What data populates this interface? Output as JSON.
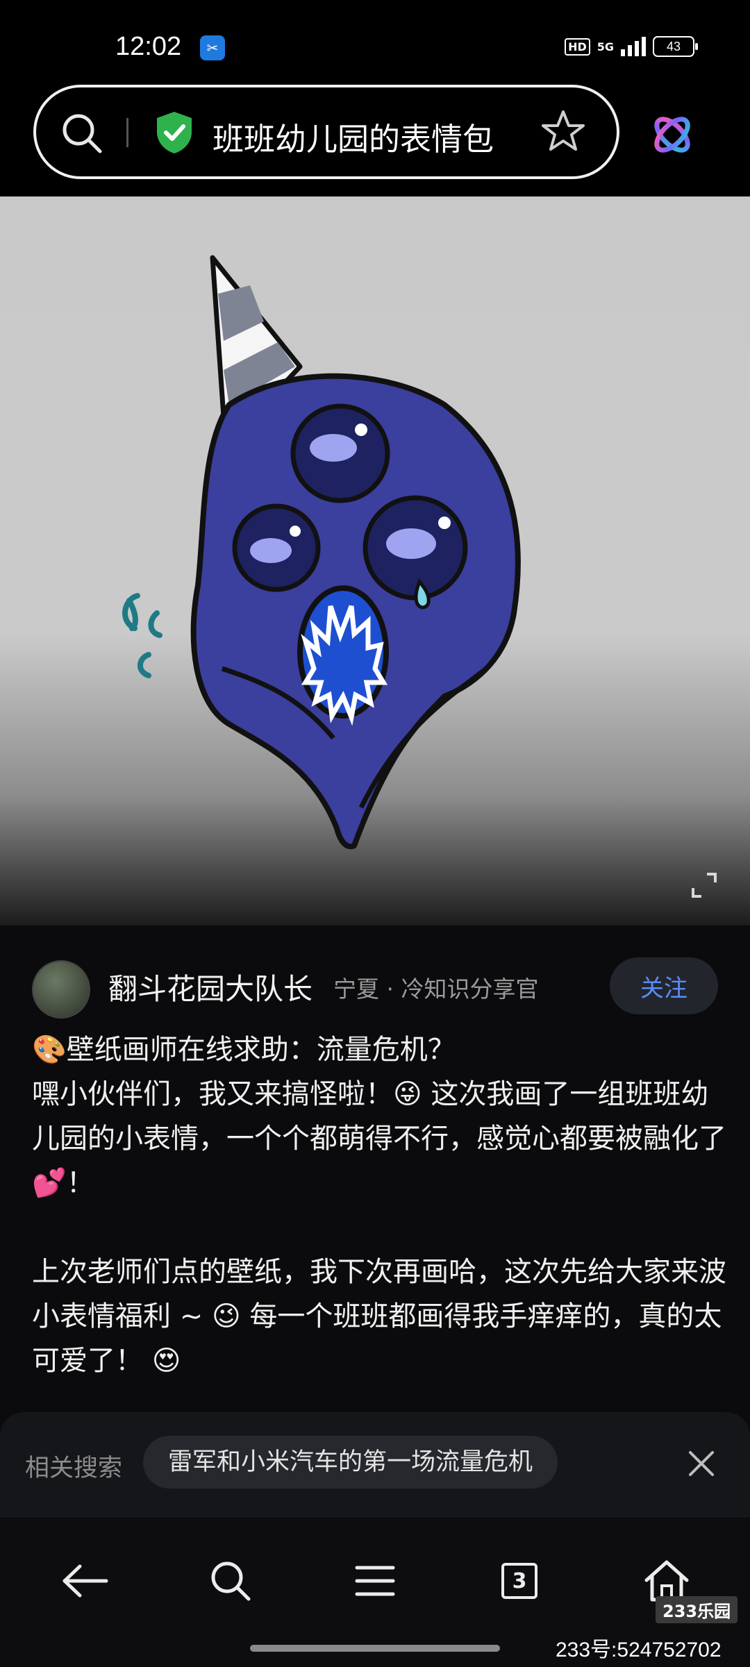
{
  "status": {
    "time": "12:02",
    "hd": "HD",
    "network": "5G",
    "battery": "43"
  },
  "search": {
    "query": "班班幼儿园的表情包"
  },
  "post": {
    "author": "翻斗花园大队长",
    "meta": "宁夏 · 冷知识分享官",
    "follow_label": "关注",
    "lines": [
      "🎨壁纸画师在线求助：流量危机？",
      "嘿小伙伴们，我又来搞怪啦！😜 这次我画了一组班班幼儿园的小表情，一个个都萌得不行，感觉心都要被融化了💕！",
      "上次老师们点的壁纸，我下次再画哈，这次先给大家来波小表情福利 ~ 😉 每一个班班都画得我手痒痒的，真的太可爱了！ 😍"
    ]
  },
  "related": {
    "label": "相关搜索",
    "chip": "雷军和小米汽车的第一场流量危机"
  },
  "nav": {
    "tab_count": "3"
  },
  "watermark": {
    "logo": "233乐园",
    "text": "233号:524752702"
  },
  "colors": {
    "accent": "#5a8cff",
    "shield": "#2fb24c",
    "character": "#3b3f9e"
  }
}
